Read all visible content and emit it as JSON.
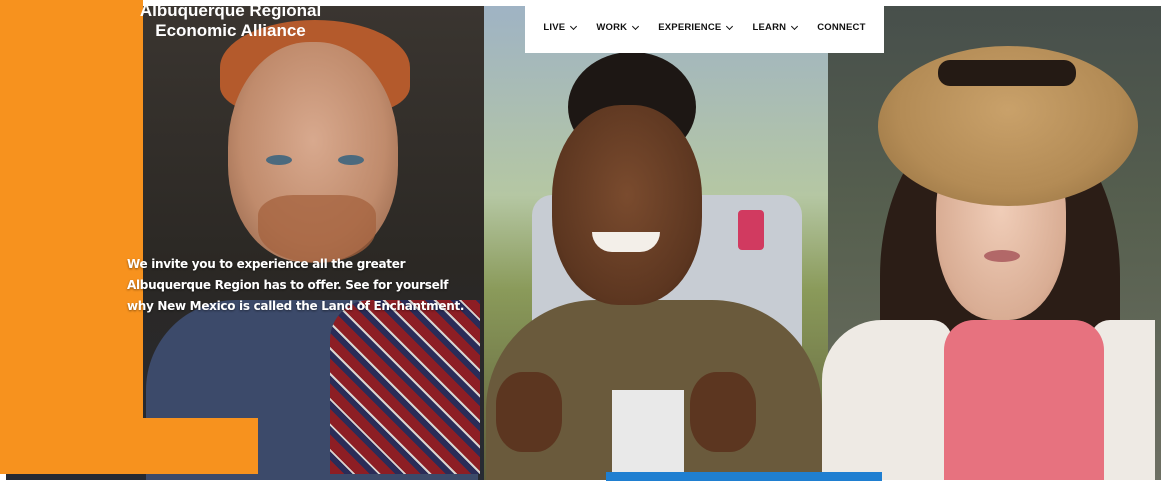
{
  "logo": {
    "line1": "Albuquerque Regional",
    "line2": "Economic Alliance"
  },
  "nav": {
    "items": [
      {
        "label": "LIVE",
        "dropdown": true
      },
      {
        "label": "WORK",
        "dropdown": true
      },
      {
        "label": "EXPERIENCE",
        "dropdown": true
      },
      {
        "label": "LEARN",
        "dropdown": true
      },
      {
        "label": "CONNECT",
        "dropdown": false
      }
    ]
  },
  "hero": {
    "lines": [
      "We invite you to experience all the greater",
      "Albuquerque Region has to offer. See for yourself",
      "why New Mexico is called the Land of Enchantment."
    ]
  },
  "colors": {
    "accent_orange": "#f7921e",
    "nav_background": "#ffffff",
    "cta_blue": "#1f7fd1"
  }
}
